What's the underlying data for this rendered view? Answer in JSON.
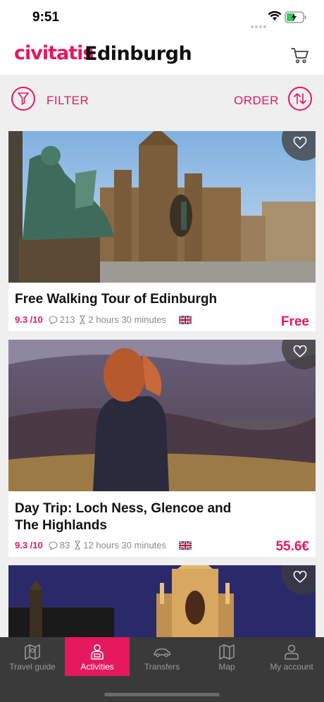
{
  "status_bar": {
    "time": "9:51"
  },
  "header": {
    "logo": "civitatis",
    "city": "Edinburgh"
  },
  "toolbar": {
    "filter_label": "FILTER",
    "order_label": "ORDER"
  },
  "activities": [
    {
      "title": "Free Walking Tour of Edinburgh",
      "rating": "9.3 /10",
      "reviews": "213",
      "duration": "2 hours 30 minutes",
      "language": "uk-flag",
      "price": "Free"
    },
    {
      "title": "Day Trip: Loch Ness, Glencoe and The Highlands",
      "rating": "9.3 /10",
      "reviews": "83",
      "duration": "12 hours 30 minutes",
      "language": "uk-flag",
      "price": "55.6€"
    },
    {
      "title": "",
      "rating": "",
      "reviews": "",
      "duration": "",
      "language": "",
      "price": ""
    }
  ],
  "tabs": [
    {
      "label": "Travel guide",
      "icon": "map-icon",
      "active": false
    },
    {
      "label": "Activities",
      "icon": "guide-icon",
      "active": true
    },
    {
      "label": "Transfers",
      "icon": "car-icon",
      "active": false
    },
    {
      "label": "Map",
      "icon": "folded-map-icon",
      "active": false
    },
    {
      "label": "My account",
      "icon": "user-icon",
      "active": false
    }
  ],
  "colors": {
    "accent": "#e5185d",
    "tabbar": "#3a3a3a",
    "background": "#efefef"
  }
}
